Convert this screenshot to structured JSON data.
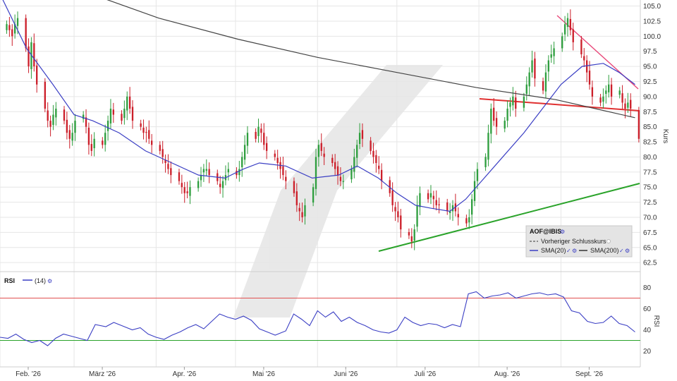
{
  "colors": {
    "up": "#2e9e3e",
    "down": "#cc1f2a",
    "sma20": "#3b3fc4",
    "sma200": "#444444",
    "support": "#2aa32a",
    "resistance_red": "#e03030",
    "resistance_pink": "#e8487a",
    "rsi_line": "#3b3fc4",
    "rsi_upper": "#e05050",
    "rsi_lower": "#2aa32a",
    "grid": "#e6e6e6"
  },
  "x_axis": {
    "labels": [
      "Feb. '26",
      "März '26",
      "Apr. '26",
      "Mai '26",
      "Juni '26",
      "Juli '26",
      "Aug. '26",
      "Sept. '26"
    ],
    "day_positions": [
      0,
      28,
      59,
      89,
      120,
      150,
      181,
      212
    ]
  },
  "legend": {
    "symbol": "AOF@IBIS",
    "prev_close": "Vorheriger Schlusskurs",
    "sma20": "SMA(20)",
    "sma200": "SMA(200)"
  },
  "rsi_panel": {
    "label": "RSI",
    "period": "(14)"
  },
  "chart_data": [
    {
      "type": "candlestick",
      "ylabel": "Kurs",
      "ylim": [
        61,
        106
      ],
      "yticks": [
        "62.5",
        "65.0",
        "67.5",
        "70.0",
        "72.5",
        "75.0",
        "77.5",
        "80.0",
        "82.5",
        "85.0",
        "87.5",
        "90.0",
        "92.5",
        "95.0",
        "97.5",
        "100.0",
        "102.5",
        "105.0"
      ],
      "x_unit": "days since 1 Feb 2026",
      "close": [
        102,
        101,
        100,
        102,
        103,
        98,
        95,
        99,
        95,
        92,
        88,
        86,
        85,
        87,
        88,
        86,
        84,
        83,
        84,
        86,
        87,
        85,
        82,
        81,
        83,
        82,
        84,
        86,
        88,
        87,
        86,
        88,
        90,
        88,
        86,
        85,
        84,
        84,
        83,
        82,
        81,
        80,
        79,
        78,
        77,
        76,
        75,
        74,
        74,
        75,
        76,
        77,
        78,
        78,
        77,
        76,
        75,
        76,
        77,
        78,
        77,
        78,
        80,
        82,
        84,
        83,
        85,
        84,
        82,
        81,
        80,
        79,
        78,
        77,
        76,
        74,
        72,
        71,
        70,
        72,
        75,
        80,
        82,
        81,
        80,
        79,
        78,
        77,
        76,
        76,
        78,
        80,
        82,
        84,
        83,
        81,
        80,
        79,
        78,
        76,
        74,
        72,
        71,
        70,
        68,
        67,
        66,
        68,
        72,
        74,
        73,
        74,
        73,
        72,
        72,
        71,
        71,
        72,
        71,
        70,
        69,
        70,
        73,
        76,
        78,
        80,
        84,
        88,
        86,
        85,
        86,
        88,
        89,
        90,
        88,
        90,
        92,
        94,
        96,
        93,
        91,
        94,
        96,
        97,
        98,
        100,
        102,
        103,
        101,
        99,
        97,
        96,
        94,
        92,
        90,
        89,
        90,
        91,
        92,
        90,
        91,
        89,
        88,
        89,
        88,
        83
      ],
      "series": [
        {
          "name": "SMA(20)",
          "values": [
            [
              0,
              107
            ],
            [
              10,
              98
            ],
            [
              20,
              92
            ],
            [
              28,
              87
            ],
            [
              35,
              86
            ],
            [
              45,
              84
            ],
            [
              55,
              81
            ],
            [
              65,
              79
            ],
            [
              75,
              77
            ],
            [
              85,
              76.5
            ],
            [
              92,
              78
            ],
            [
              98,
              79
            ],
            [
              108,
              78.5
            ],
            [
              118,
              76.5
            ],
            [
              128,
              77
            ],
            [
              135,
              78.5
            ],
            [
              143,
              76.5
            ],
            [
              150,
              74
            ],
            [
              157,
              72
            ],
            [
              163,
              71.5
            ],
            [
              170,
              71
            ],
            [
              176,
              73
            ],
            [
              182,
              76
            ],
            [
              190,
              80
            ],
            [
              198,
              84
            ],
            [
              205,
              88
            ],
            [
              212,
              92
            ],
            [
              220,
              95
            ],
            [
              228,
              95.5
            ],
            [
              234,
              94
            ],
            [
              240,
              92
            ]
          ]
        },
        {
          "name": "SMA(200)",
          "values": [
            [
              28,
              108
            ],
            [
              60,
              103
            ],
            [
              90,
              99.5
            ],
            [
              120,
              96.5
            ],
            [
              150,
              94
            ],
            [
              180,
              91.5
            ],
            [
              210,
              89.5
            ],
            [
              225,
              88
            ],
            [
              240,
              86.5
            ]
          ]
        }
      ]
    },
    {
      "type": "line",
      "ylabel": "RSI",
      "ylim": [
        5,
        95
      ],
      "yticks": [
        "20",
        "40",
        "60",
        "80"
      ],
      "overbought": 70,
      "oversold": 30,
      "x_unit": "days since 1 Feb 2026",
      "series": [
        {
          "name": "RSI(14)",
          "values": [
            [
              0,
              33
            ],
            [
              3,
              32
            ],
            [
              6,
              36
            ],
            [
              9,
              31
            ],
            [
              12,
              28
            ],
            [
              15,
              30
            ],
            [
              18,
              25
            ],
            [
              21,
              32
            ],
            [
              24,
              36
            ],
            [
              27,
              34
            ],
            [
              30,
              32
            ],
            [
              33,
              30
            ],
            [
              36,
              45
            ],
            [
              40,
              43
            ],
            [
              43,
              47
            ],
            [
              46,
              44
            ],
            [
              50,
              40
            ],
            [
              53,
              42
            ],
            [
              56,
              36
            ],
            [
              59,
              33
            ],
            [
              62,
              31
            ],
            [
              65,
              35
            ],
            [
              68,
              38
            ],
            [
              71,
              42
            ],
            [
              74,
              45
            ],
            [
              77,
              41
            ],
            [
              80,
              48
            ],
            [
              83,
              55
            ],
            [
              86,
              52
            ],
            [
              89,
              50
            ],
            [
              92,
              53
            ],
            [
              95,
              49
            ],
            [
              98,
              41
            ],
            [
              101,
              38
            ],
            [
              104,
              35
            ],
            [
              108,
              39
            ],
            [
              111,
              55
            ],
            [
              114,
              50
            ],
            [
              117,
              44
            ],
            [
              120,
              58
            ],
            [
              123,
              52
            ],
            [
              126,
              57
            ],
            [
              129,
              48
            ],
            [
              132,
              52
            ],
            [
              135,
              47
            ],
            [
              138,
              44
            ],
            [
              141,
              40
            ],
            [
              144,
              38
            ],
            [
              147,
              37
            ],
            [
              150,
              40
            ],
            [
              153,
              52
            ],
            [
              156,
              47
            ],
            [
              159,
              44
            ],
            [
              162,
              46
            ],
            [
              165,
              45
            ],
            [
              168,
              42
            ],
            [
              171,
              45
            ],
            [
              174,
              43
            ],
            [
              177,
              74
            ],
            [
              180,
              76
            ],
            [
              183,
              70
            ],
            [
              186,
              72
            ],
            [
              189,
              73
            ],
            [
              192,
              75
            ],
            [
              195,
              70
            ],
            [
              198,
              72
            ],
            [
              201,
              74
            ],
            [
              204,
              75
            ],
            [
              207,
              73
            ],
            [
              210,
              74
            ],
            [
              213,
              71
            ],
            [
              216,
              58
            ],
            [
              219,
              56
            ],
            [
              222,
              48
            ],
            [
              225,
              46
            ],
            [
              228,
              47
            ],
            [
              231,
              53
            ],
            [
              234,
              46
            ],
            [
              237,
              44
            ],
            [
              240,
              38
            ]
          ]
        }
      ]
    }
  ]
}
